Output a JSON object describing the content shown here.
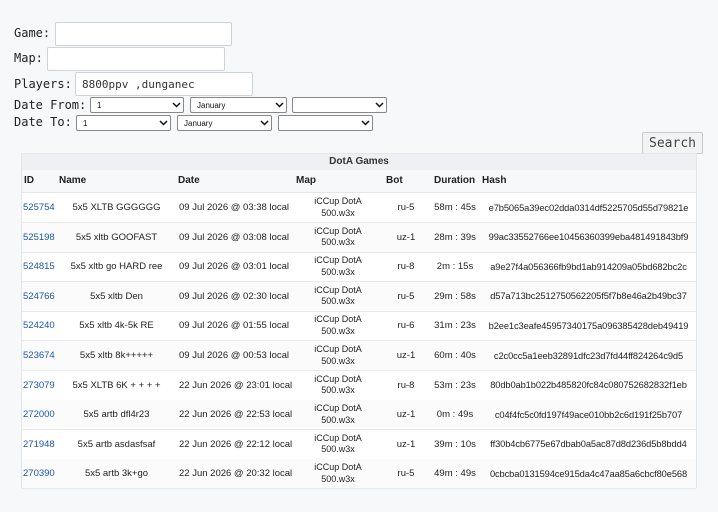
{
  "form": {
    "game_label": "Game:",
    "map_label": "Map:",
    "players_label": "Players:",
    "players_value": "8800ppv ,dunganec",
    "date_from_label": "Date From:",
    "date_to_label": "Date To:",
    "from_day": "1",
    "from_month": "January",
    "from_year": "",
    "to_day": "1",
    "to_month": "January",
    "to_year": "",
    "search_label": "Search"
  },
  "table": {
    "title": "DotA Games",
    "columns": [
      "ID",
      "Name",
      "Date",
      "Map",
      "Bot",
      "Duration",
      "Hash"
    ],
    "rows": [
      {
        "id": "525754",
        "name": "5x5 XLTB GGGGGG",
        "date": "09 Jul 2026 @ 03:38 local",
        "map_line1": "iCCup DotA",
        "map_line2": "500.w3x",
        "bot": "ru-5",
        "duration": "58m : 45s",
        "hash": "e7b5065a39ec02dda0314df5225705d55d79821e"
      },
      {
        "id": "525198",
        "name": "5x5 xltb GOOFAST",
        "date": "09 Jul 2026 @ 03:08 local",
        "map_line1": "iCCup DotA",
        "map_line2": "500.w3x",
        "bot": "uz-1",
        "duration": "28m : 39s",
        "hash": "99ac33552766ee10456360399eba481491843bf9"
      },
      {
        "id": "524815",
        "name": "5x5 xltb go HARD ree",
        "date": "09 Jul 2026 @ 03:01 local",
        "map_line1": "iCCup DotA",
        "map_line2": "500.w3x",
        "bot": "ru-8",
        "duration": "2m : 15s",
        "hash": "a9e27f4a056366fb9bd1ab914209a05bd682bc2c"
      },
      {
        "id": "524766",
        "name": "5x5 xltb Den",
        "date": "09 Jul 2026 @ 02:30 local",
        "map_line1": "iCCup DotA",
        "map_line2": "500.w3x",
        "bot": "ru-5",
        "duration": "29m : 58s",
        "hash": "d57a713bc2512750562205f5f7b8e46a2b49bc37"
      },
      {
        "id": "524240",
        "name": "5x5 xltb 4k-5k RE",
        "date": "09 Jul 2026 @ 01:55 local",
        "map_line1": "iCCup DotA",
        "map_line2": "500.w3x",
        "bot": "ru-6",
        "duration": "31m : 23s",
        "hash": "b2ee1c3eafe45957340175a096385428deb49419"
      },
      {
        "id": "523674",
        "name": "5x5 xltb 8k+++++",
        "date": "09 Jul 2026 @ 00:53 local",
        "map_line1": "iCCup DotA",
        "map_line2": "500.w3x",
        "bot": "uz-1",
        "duration": "60m : 40s",
        "hash": "c2c0cc5a1eeb32891dfc23d7fd44ff824264c9d5"
      },
      {
        "id": "273079",
        "name": "5x5 XLTB 6K + + + +",
        "date": "22 Jun 2026 @ 23:01 local",
        "map_line1": "iCCup DotA",
        "map_line2": "500.w3x",
        "bot": "ru-8",
        "duration": "53m : 23s",
        "hash": "80db0ab1b022b485820fc84c080752682832f1eb"
      },
      {
        "id": "272000",
        "name": "5x5 artb dfl4r23",
        "date": "22 Jun 2026 @ 22:53 local",
        "map_line1": "iCCup DotA",
        "map_line2": "500.w3x",
        "bot": "uz-1",
        "duration": "0m : 49s",
        "hash": "c04f4fc5c0fd197f49ace010bb2c6d191f25b707"
      },
      {
        "id": "271948",
        "name": "5x5 artb asdasfsaf",
        "date": "22 Jun 2026 @ 22:12 local",
        "map_line1": "iCCup DotA",
        "map_line2": "500.w3x",
        "bot": "uz-1",
        "duration": "39m : 10s",
        "hash": "ff30b4cb6775e67dbab0a5ac87d8d236d5b8bdd4"
      },
      {
        "id": "270390",
        "name": "5x5 artb 3k+go",
        "date": "22 Jun 2026 @ 20:32 local",
        "map_line1": "iCCup DotA",
        "map_line2": "500.w3x",
        "bot": "ru-5",
        "duration": "49m : 49s",
        "hash": "0cbcba0131594ce915da4c47aa85a6cbcf80e568"
      }
    ]
  }
}
